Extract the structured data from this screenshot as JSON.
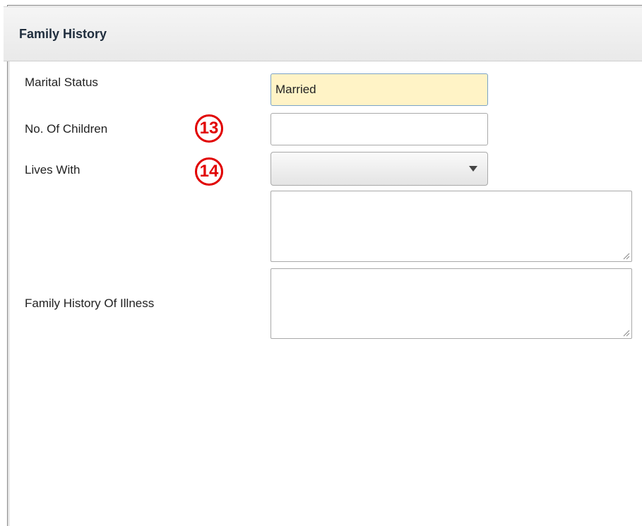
{
  "panel": {
    "title": "Family History"
  },
  "fields": {
    "marital_status": {
      "label": "Marital Status",
      "value": "Married"
    },
    "no_of_children": {
      "label": "No. Of Children",
      "value": "",
      "annotation": "13"
    },
    "lives_with": {
      "label": "Lives With",
      "selected": "",
      "annotation": "14"
    },
    "lives_with_notes": {
      "value": ""
    },
    "family_history_of_illness": {
      "label": "Family History Of Illness",
      "value": ""
    }
  },
  "colors": {
    "annotation": "#e10000",
    "highlight_fill": "#fff3c6",
    "header_text": "#1f2d3d"
  }
}
